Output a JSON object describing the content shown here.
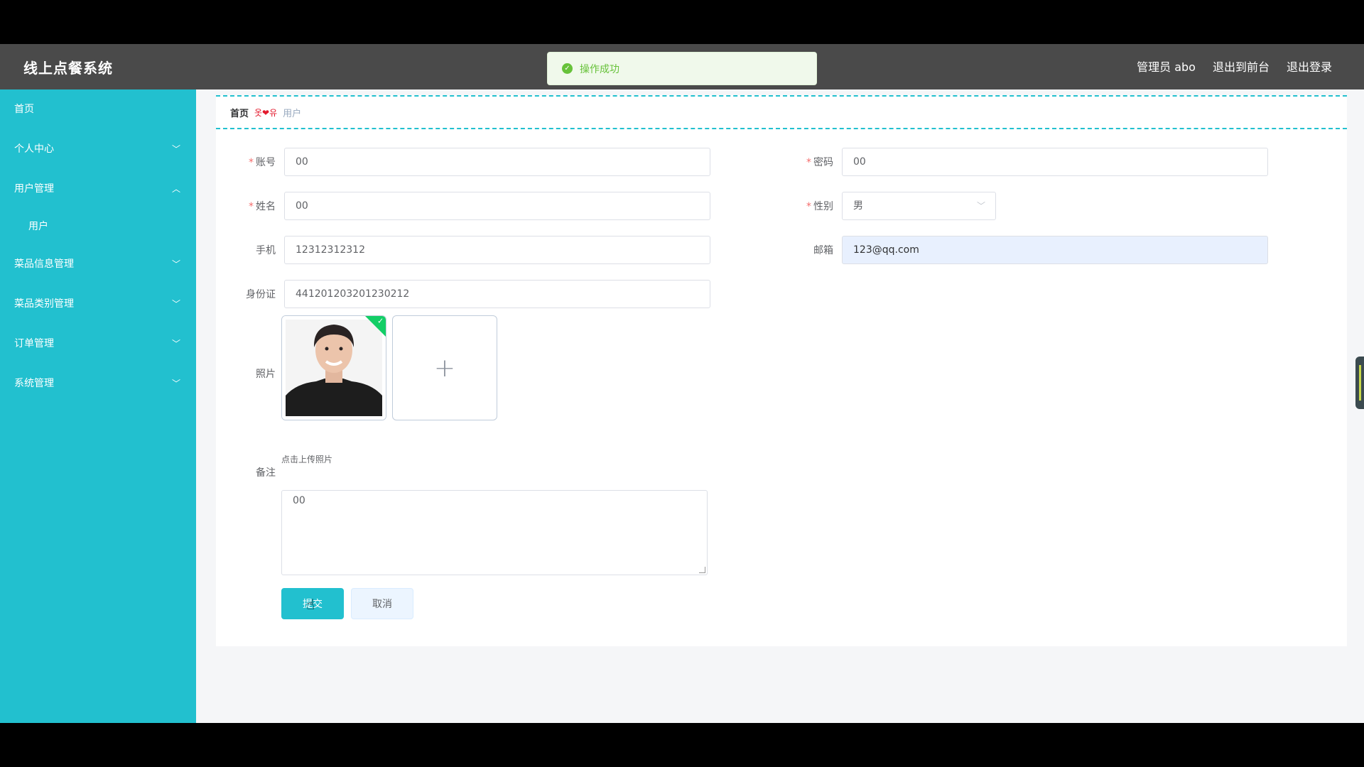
{
  "app": {
    "title": "线上点餐系统"
  },
  "header": {
    "user": "管理员 abo",
    "to_front": "退出到前台",
    "logout": "退出登录"
  },
  "toast": {
    "message": "操作成功",
    "icon": "check-circle-icon",
    "color": "#67c23a"
  },
  "sidebar": {
    "items": [
      {
        "label": "首页"
      },
      {
        "label": "个人中心",
        "icon": "chevron-down-icon"
      },
      {
        "label": "用户管理",
        "icon": "chevron-up-icon",
        "expanded": true,
        "children": [
          {
            "label": "用户"
          }
        ]
      },
      {
        "label": "菜品信息管理",
        "icon": "chevron-down-icon"
      },
      {
        "label": "菜品类别管理",
        "icon": "chevron-down-icon"
      },
      {
        "label": "订单管理",
        "icon": "chevron-down-icon"
      },
      {
        "label": "系统管理",
        "icon": "chevron-down-icon"
      }
    ],
    "accent": "#22c0cf"
  },
  "breadcrumb": {
    "home": "首页",
    "separator": "옷❤유",
    "current": "用户"
  },
  "form": {
    "account": {
      "label": "账号",
      "value": "00",
      "required": true
    },
    "password": {
      "label": "密码",
      "value": "00",
      "required": true
    },
    "name": {
      "label": "姓名",
      "value": "00",
      "required": true
    },
    "gender": {
      "label": "性别",
      "value": "男",
      "required": true
    },
    "phone": {
      "label": "手机",
      "value": "12312312312"
    },
    "email": {
      "label": "邮箱",
      "value": "123@qq.com"
    },
    "id_card": {
      "label": "身份证",
      "value": "441201203201230212"
    },
    "photo": {
      "label": "照片",
      "tip": "点击上传照片",
      "add_icon": "plus-icon"
    },
    "remark": {
      "label": "备注",
      "value": "00"
    },
    "submit": "提交",
    "cancel": "取消"
  }
}
